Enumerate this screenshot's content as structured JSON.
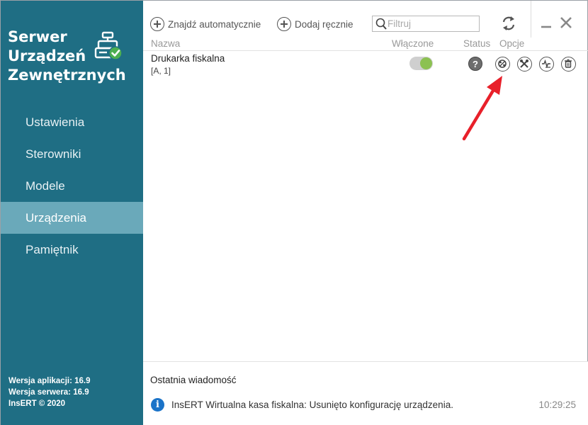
{
  "sidebar": {
    "title_lines": [
      "Serwer",
      "Urządzeń",
      "Zewnętrznych"
    ],
    "nav": [
      {
        "label": "Ustawienia",
        "active": false
      },
      {
        "label": "Sterowniki",
        "active": false
      },
      {
        "label": "Modele",
        "active": false
      },
      {
        "label": "Urządzenia",
        "active": true
      },
      {
        "label": "Pamiętnik",
        "active": false
      }
    ],
    "versions": {
      "app": "Wersja aplikacji: 16.9",
      "server": "Wersja serwera: 16.9",
      "copyright": "InsERT © 2020"
    }
  },
  "toolbar": {
    "find_auto_label": "Znajdź automatycznie",
    "add_manual_label": "Dodaj ręcznie",
    "filter_placeholder": "Filtruj",
    "icons": {
      "refresh": "refresh-icon",
      "minimize": "minimize-icon",
      "close": "close-icon"
    }
  },
  "grid": {
    "columns": {
      "name": "Nazwa",
      "enabled": "Włączone",
      "status": "Status",
      "options": "Opcje"
    },
    "rows": [
      {
        "name": "Drukarka fiskalna",
        "sub": "[A, 1]",
        "enabled": true,
        "status_glyph": "?",
        "options": [
          "connection-test-icon",
          "settings-tools-icon",
          "diagnostics-icon",
          "delete-icon"
        ]
      }
    ]
  },
  "message": {
    "title": "Ostatnia wiadomość",
    "text": "InsERT Wirtualna kasa fiskalna: Usunięto konfigurację urządzenia.",
    "time": "10:29:25",
    "icon_glyph": "i"
  },
  "colors": {
    "sidebar_bg": "#1f6e84",
    "nav_active_bg": "#6aa9ba",
    "toggle_on": "#8cc152",
    "logo_check": "#4caf50",
    "info_blue": "#1a73c8",
    "arrow_red": "#e8202a"
  }
}
